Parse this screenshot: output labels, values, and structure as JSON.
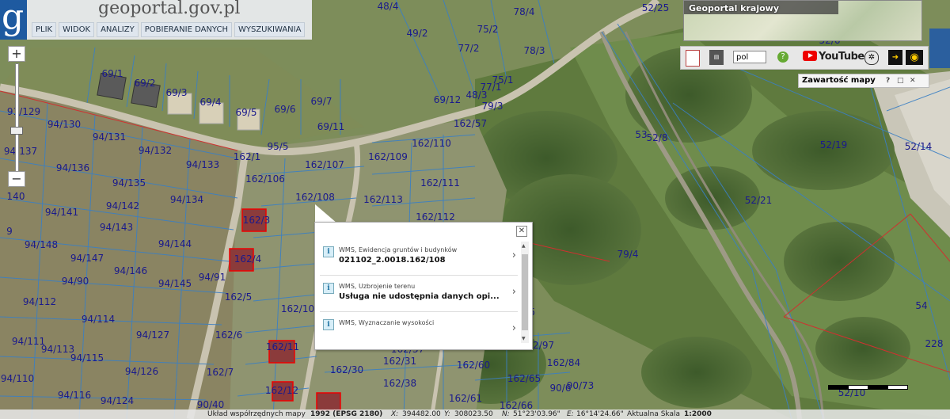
{
  "header": {
    "site_title": "geoportal.gov.pl",
    "menu": [
      "PLIK",
      "WIDOK",
      "ANALIZY",
      "POBIERANIE DANYCH",
      "WYSZUKIWANIA"
    ]
  },
  "zoom": {
    "plus": "+",
    "minus": "−"
  },
  "overview": {
    "title": "Geoportal krajowy"
  },
  "toolbar": {
    "language": "pol",
    "youtube": "YouTube"
  },
  "layers_panel": {
    "title": "Zawartość mapy",
    "help": "?",
    "restore": "□",
    "close": "✕"
  },
  "popup": {
    "close": "✕",
    "items": [
      {
        "source": "WMS, Ewidencja gruntów i budynków",
        "value": "021102_2.0018.162/108"
      },
      {
        "source": "WMS, Uzbrojenie terenu",
        "value": "Usługa nie udostępnia danych opi..."
      },
      {
        "source": "WMS, Wyznaczanie wysokości",
        "value": ""
      }
    ]
  },
  "footer": {
    "crs_label": "Układ współrzędnych mapy",
    "crs_value": "1992 (EPSG 2180)",
    "x_label": "X:",
    "x_value": "394482.00",
    "y_label": "Y:",
    "y_value": "308023.50",
    "n_label": "N:",
    "n_value": "51°23'03.96\"",
    "e_label": "E:",
    "e_value": "16°14'24.66\"",
    "scale_label": "Aktualna Skala",
    "scale_value": "1:2000"
  },
  "parcels": [
    "48/4",
    "78/4",
    "75/2",
    "49/2",
    "77/2",
    "78/3",
    "69/1",
    "69/2",
    "69/3",
    "69/4",
    "69/5",
    "69/6",
    "69/7",
    "69/11",
    "69/12",
    "48/3",
    "75/1",
    "77/1",
    "79/3",
    "162/57",
    "162/1",
    "95/5",
    "91/129",
    "94/130",
    "94/131",
    "94/132",
    "94/133",
    "94/136",
    "94/137",
    "94/135",
    "94/142",
    "94/134",
    "94/141",
    "94/143",
    "94/148",
    "94/147",
    "94/144",
    "94/146",
    "94/145",
    "94/90",
    "94/112",
    "94/114",
    "94/127",
    "94/111",
    "94/113",
    "94/115",
    "94/126",
    "94/110",
    "94/116",
    "94/124",
    "90/40",
    "162/106",
    "162/107",
    "162/108",
    "162/109",
    "162/110",
    "162/111",
    "162/113",
    "162/112",
    "162/3",
    "162/4",
    "162/5",
    "162/6",
    "162/7",
    "162/10",
    "162/11",
    "162/12",
    "162/30",
    "162/31",
    "162/37",
    "162/38",
    "162/60",
    "162/61",
    "162/65",
    "162/66",
    "162/84",
    "162/95",
    "162/97",
    "90/73",
    "90/6",
    "53",
    "52/8",
    "52/19",
    "52/14",
    "52/21",
    "52/6",
    "52/25",
    "79/4",
    "54",
    "228",
    "52/10",
    "140",
    "9",
    "94/91"
  ]
}
